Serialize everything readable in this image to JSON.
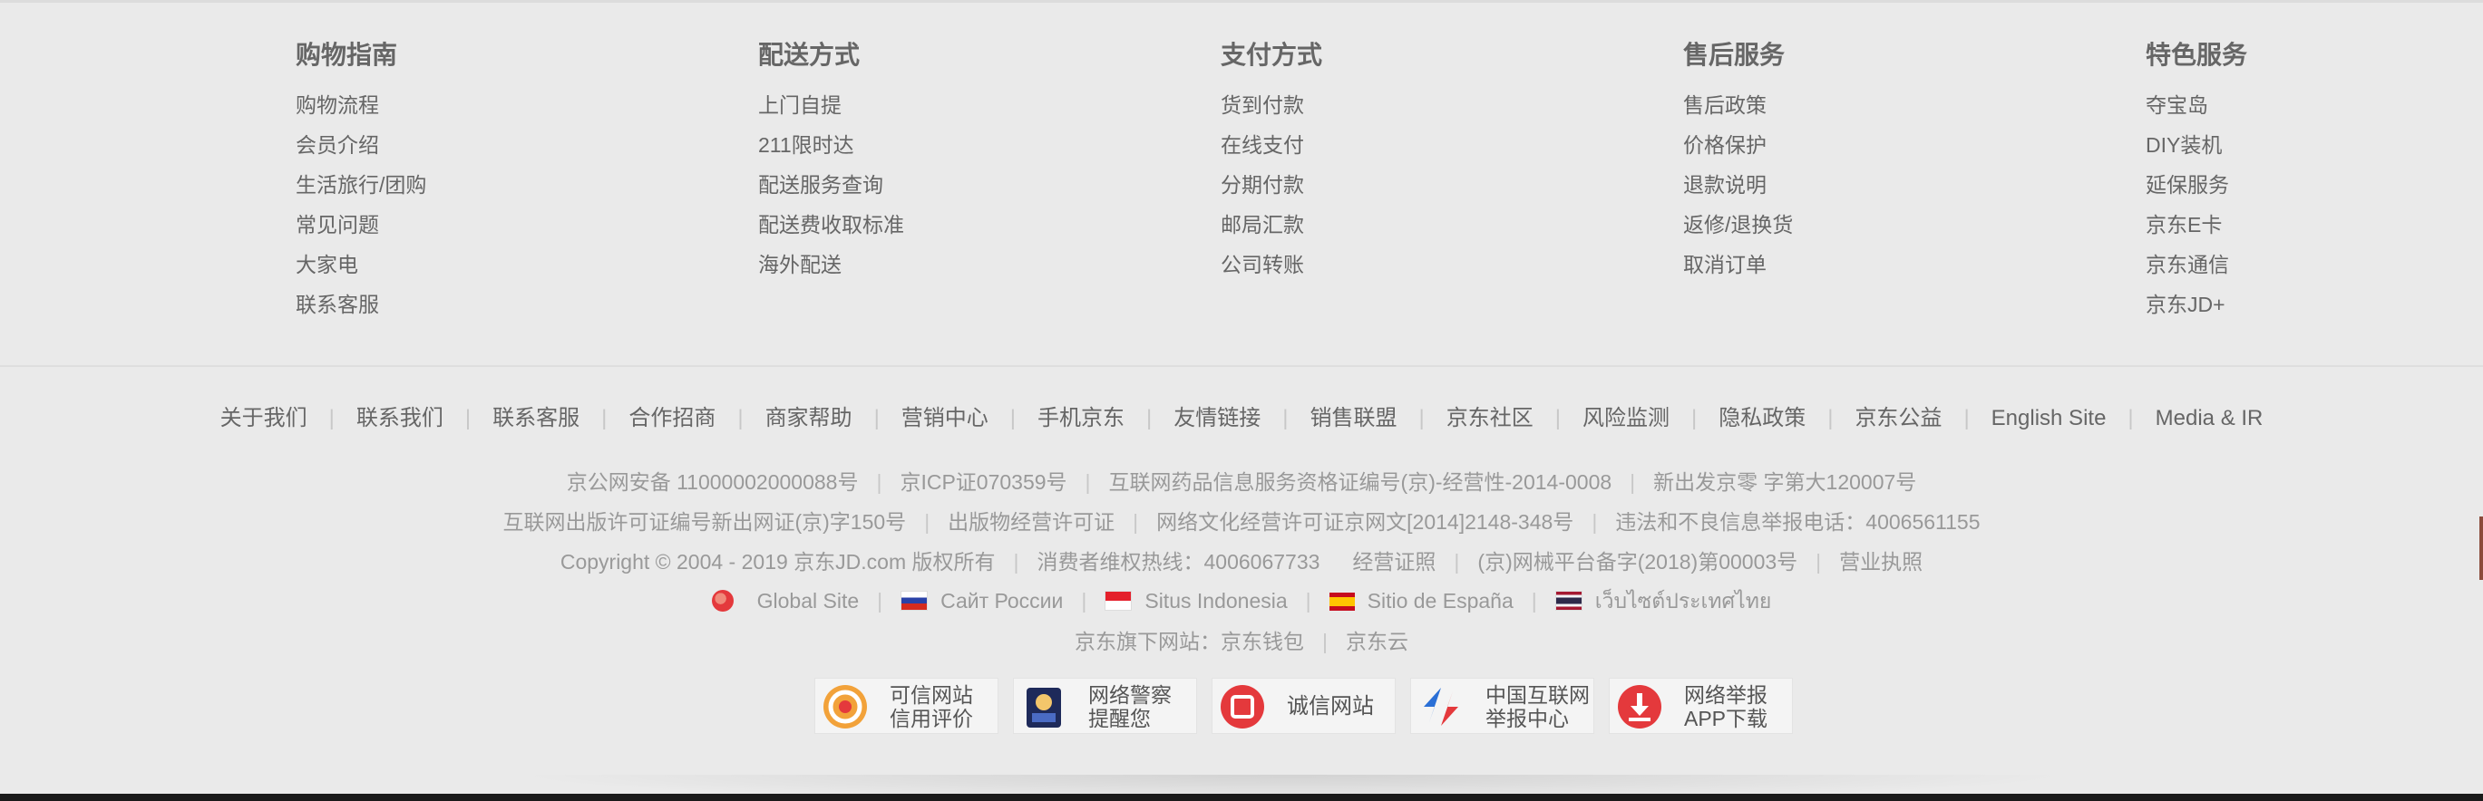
{
  "guide": [
    {
      "title": "购物指南",
      "items": [
        "购物流程",
        "会员介绍",
        "生活旅行/团购",
        "常见问题",
        "大家电",
        "联系客服"
      ]
    },
    {
      "title": "配送方式",
      "items": [
        "上门自提",
        "211限时达",
        "配送服务查询",
        "配送费收取标准",
        "海外配送"
      ]
    },
    {
      "title": "支付方式",
      "items": [
        "货到付款",
        "在线支付",
        "分期付款",
        "邮局汇款",
        "公司转账"
      ]
    },
    {
      "title": "售后服务",
      "items": [
        "售后政策",
        "价格保护",
        "退款说明",
        "返修/退换货",
        "取消订单"
      ]
    },
    {
      "title": "特色服务",
      "items": [
        "夺宝岛",
        "DIY装机",
        "延保服务",
        "京东E卡",
        "京东通信",
        "京东JD+"
      ]
    }
  ],
  "links": [
    "关于我们",
    "联系我们",
    "联系客服",
    "合作招商",
    "商家帮助",
    "营销中心",
    "手机京东",
    "友情链接",
    "销售联盟",
    "京东社区",
    "风险监测",
    "隐私政策",
    "京东公益",
    "English Site",
    "Media & IR"
  ],
  "license": {
    "line1": [
      "京公网安备 11000002000088号",
      "京ICP证070359号",
      "互联网药品信息服务资格证编号(京)-经营性-2014-0008",
      "新出发京零 字第大120007号"
    ],
    "line2": [
      "互联网出版许可证编号新出网证(京)字150号",
      "出版物经营许可证",
      "网络文化经营许可证京网文[2014]2148-348号",
      "违法和不良信息举报电话：4006561155"
    ],
    "line3": [
      "Copyright © 2004 - 2019  京东JD.com 版权所有",
      "消费者维权热线：4006067733",
      "经营证照",
      "(京)网械平台备字(2018)第00003号",
      "营业执照"
    ],
    "line3_sep_pattern": "a|b c|d|e"
  },
  "global_sites": [
    {
      "label": "Global Site",
      "icon": "globe-icon"
    },
    {
      "label": "Сайт России",
      "icon": "russia-flag-icon"
    },
    {
      "label": "Situs Indonesia",
      "icon": "indonesia-flag-icon"
    },
    {
      "label": "Sitio de España",
      "icon": "spain-flag-icon"
    },
    {
      "label": "เว็บไซต์ประเทศไทย",
      "icon": "thailand-flag-icon"
    }
  ],
  "subsites": {
    "prefix": "京东旗下网站：",
    "items": [
      "京东钱包",
      "京东云"
    ]
  },
  "badges": [
    {
      "icon": "trusted-site-icon",
      "lines": [
        "可信网站",
        "信用评价"
      ]
    },
    {
      "icon": "police-alert-icon",
      "lines": [
        "网络警察",
        "提醒您"
      ]
    },
    {
      "icon": "integrity-site-icon",
      "lines": [
        "诚信网站"
      ]
    },
    {
      "icon": "china-internet-report-icon",
      "lines": [
        "中国互联网",
        "举报中心"
      ]
    },
    {
      "icon": "report-app-download-icon",
      "lines": [
        "网络举报",
        "APP下载"
      ]
    }
  ],
  "colors": {
    "background": "#eaeaea",
    "text": "#666666",
    "muted": "#999999",
    "accent": "#e4393c"
  }
}
